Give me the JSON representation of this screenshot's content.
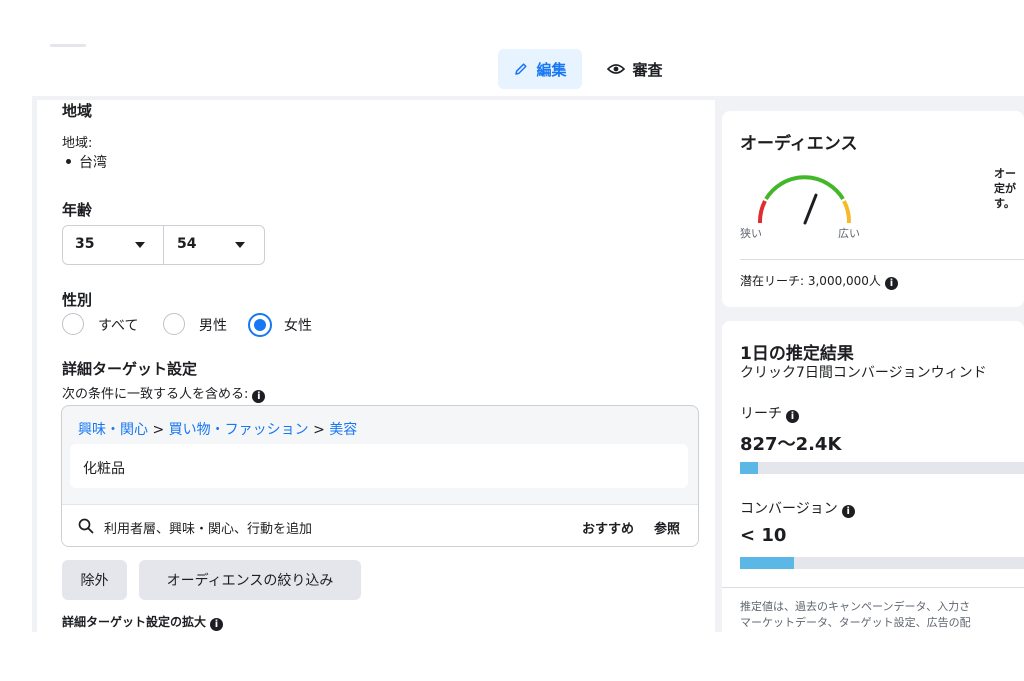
{
  "toolbar": {
    "edit_label": "編集",
    "review_label": "審査"
  },
  "audience_form": {
    "location": {
      "heading": "地域",
      "sub_label": "地域:",
      "items": [
        "台湾"
      ]
    },
    "age": {
      "heading": "年齢",
      "min": "35",
      "max": "54"
    },
    "gender": {
      "heading": "性別",
      "options": [
        "すべて",
        "男性",
        "女性"
      ],
      "selected": "女性"
    },
    "detailed_targeting": {
      "heading": "詳細ターゲット設定",
      "include_label": "次の条件に一致する人を含める:",
      "breadcrumb": [
        "興味・関心",
        "買い物・ファッション",
        "美容"
      ],
      "selected_item": "化粧品",
      "search_placeholder": "利用者層、興味・関心、行動を追加",
      "suggest_label": "おすすめ",
      "browse_label": "参照",
      "exclude_button": "除外",
      "narrow_button": "オーディエンスの絞り込み",
      "expansion_label": "詳細ターゲット設定の拡大"
    }
  },
  "audience_card": {
    "title": "オーディエンス",
    "gauge_narrow": "狭い",
    "gauge_broad": "広い",
    "gauge_level": 0.62,
    "description_clipped": [
      "オー",
      "定が",
      "す。"
    ],
    "potential_reach": "潜在リーチ: 3,000,000人",
    "colors": {
      "narrow": "#e02d2d",
      "mid": "#42b72a",
      "broad": "#f7b928"
    }
  },
  "daily_results": {
    "title": "1日の推定結果",
    "subtitle": "クリック7日間コンバージョンウィンド",
    "reach_label": "リーチ",
    "reach_value": "827〜2.4K",
    "reach_fill": 0.065,
    "conversion_label": "コンバージョン",
    "conversion_value": "< 10",
    "conversion_fill": 0.19,
    "footnote_line1": "推定値は、過去のキャンペーンデータ、入力さ",
    "footnote_line2": "マーケットデータ、ターゲット設定、広告の配"
  }
}
